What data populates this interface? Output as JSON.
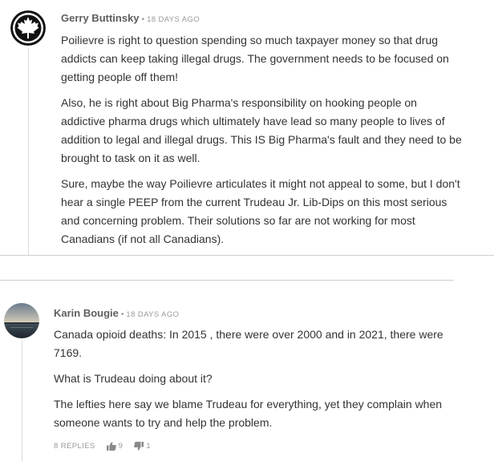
{
  "comments": [
    {
      "author": "Gerry Buttinsky",
      "separator": "•",
      "time": "18 DAYS AGO",
      "avatar_icon": "maple-leaf-icon",
      "paragraphs": [
        "Poilievre is right to question spending so much taxpayer money so that drug addicts can keep taking illegal drugs. The government needs to be focused on getting people off them!",
        "Also, he is right about Big Pharma's responsibility on hooking people on addictive pharma drugs which ultimately have lead so many people to lives of addition to legal and illegal drugs. This IS Big Pharma's fault and they need to be brought to task on it as well.",
        "Sure, maybe the way Poilievre articulates it might not appeal to some, but I don't hear a single PEEP from the current Trudeau Jr. Lib-Dips on this most serious and concerning problem. Their solutions so far are not working for most Canadians (if not all Canadians)."
      ]
    },
    {
      "author": "Karin Bougie",
      "separator": "•",
      "time": "18 DAYS AGO",
      "avatar_icon": "ocean-sunset-photo",
      "paragraphs": [
        "Canada opioid deaths: In 2015 , there were over 2000 and in 2021, there were 7169.",
        "What is Trudeau doing about it?",
        "The lefties here say we blame Trudeau for everything, yet they complain when someone wants to try and help the problem."
      ],
      "actions": {
        "replies": "8 REPLIES",
        "upvotes": "9",
        "downvotes": "1",
        "upvote_icon": "thumbs-up-icon",
        "downvote_icon": "thumbs-down-icon"
      }
    }
  ],
  "colors": {
    "author": "#5e5e5e",
    "text": "#333333",
    "muted": "#999999",
    "divider": "#cfcfcf"
  }
}
